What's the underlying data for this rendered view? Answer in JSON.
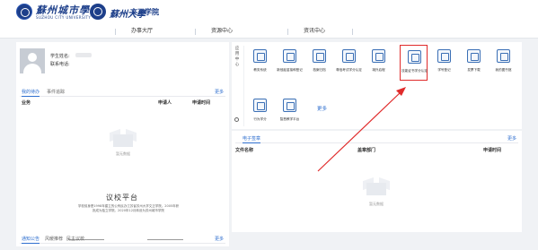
{
  "header": {
    "logo1_text": "蘇州城市學院",
    "logo1_sub": "SUZHOU CITY UNIVERSITY",
    "logo2_text_a": "蘇州大學",
    "logo2_text_b": "文正学院"
  },
  "nav": {
    "items": [
      "办事大厅",
      "资源中心",
      "资讯中心"
    ]
  },
  "user": {
    "name_label": "学生姓名:",
    "phone_label": "联系电话:"
  },
  "left_tabs": {
    "tab1": "我的待办",
    "tab2": "事件追踪",
    "more": "更多",
    "col1": "业务",
    "col2": "申请人",
    "col3": "申请时间",
    "empty": "暂无数据"
  },
  "platform": {
    "title": "议校平台",
    "desc": "学校前身是1998年建立的公有民办江苏省苏州大学文正学院。2005年获批成为独立学院。2020年12月转设为苏州城市学院"
  },
  "bottom_tabs": {
    "tab1": "通知公告",
    "tab2": "风暖推荐",
    "tab3": "民主议校",
    "more": "更多"
  },
  "apps": {
    "label": "应用中心",
    "row1": [
      "教务系统",
      "新冠疫苗接种登记",
      "档案归档",
      "尊信考试学分认定",
      "境外启程",
      "技能证书学分认定",
      "学号登记",
      "发票下载",
      "我的图书馆"
    ],
    "row2": [
      "行为学分",
      "智慧教学平台"
    ],
    "more": "更多"
  },
  "e_archive": {
    "tab": "电子签章",
    "more": "更多",
    "col1": "文件名称",
    "col2": "盖章部门",
    "col3": "申请时间",
    "empty": "暂无数据"
  },
  "colors": {
    "accent": "#2f6fcf",
    "brand": "#1d3f8a",
    "highlight": "#e02b2b"
  }
}
